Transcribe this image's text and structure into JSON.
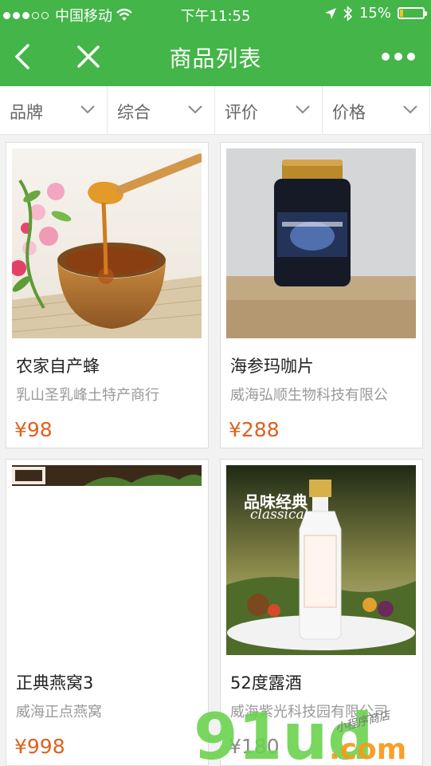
{
  "status_bar": {
    "carrier": "中国移动",
    "time": "下午11:55",
    "battery_percent": "15%",
    "battery_level": 0.15
  },
  "nav": {
    "title": "商品列表",
    "back_icon": "chevron-left-icon",
    "close_icon": "close-icon",
    "more_icon": "more-dots-icon"
  },
  "filters": [
    {
      "label": "品牌"
    },
    {
      "label": "综合"
    },
    {
      "label": "评价"
    },
    {
      "label": "价格"
    }
  ],
  "products": [
    {
      "name": "农家自产蜂",
      "shop": "乳山圣乳峰土特产商行",
      "price": "¥98",
      "image": "honey-bowl-photo"
    },
    {
      "name": "海参玛咖片",
      "shop": "威海弘顺生物科技有限公",
      "price": "¥288",
      "image": "supplement-jar-photo"
    },
    {
      "name": "正典燕窝3",
      "shop": "威海正点燕窝",
      "price": "¥998",
      "image": "birds-nest-photo"
    },
    {
      "name": "52度露酒",
      "shop": "威海紫光科技园有限公司",
      "price": "¥180",
      "image": "liquor-bottle-photo",
      "poster_text": [
        "品味经典",
        "classical"
      ]
    }
  ],
  "watermark": {
    "brand": "91ud.com",
    "tagline": "小程序商店"
  },
  "colors": {
    "brand_green": "#44b549",
    "price_orange": "#e0601e",
    "watermark_green": "#6bd34f",
    "watermark_orange": "#f79b1f"
  }
}
